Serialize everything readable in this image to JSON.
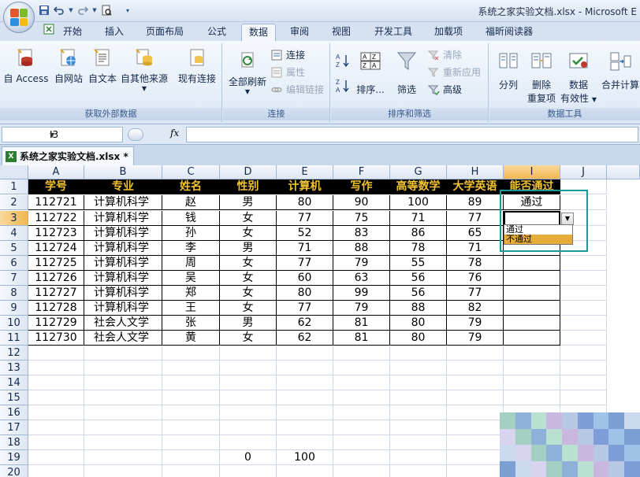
{
  "window": {
    "title": "系统之家实验文档.xlsx - Microsoft E"
  },
  "qat": {
    "icons": [
      "save-icon",
      "undo-icon",
      "redo-icon",
      "print-preview-icon",
      "customize-icon"
    ]
  },
  "tabs": [
    "开始",
    "插入",
    "页面布局",
    "公式",
    "数据",
    "审阅",
    "视图",
    "开发工具",
    "加载项",
    "福昕阅读器"
  ],
  "active_tab": "数据",
  "ribbon": {
    "groups": {
      "external": {
        "label": "获取外部数据",
        "buttons": [
          "自 Access",
          "自网站",
          "自文本",
          "自其他来源",
          "现有连接"
        ]
      },
      "connections": {
        "label": "连接",
        "refresh": "全部刷新",
        "items": [
          "连接",
          "属性",
          "编辑链接"
        ]
      },
      "sort_filter": {
        "label": "排序和筛选",
        "sort": "排序...",
        "filter": "筛选",
        "items": [
          "清除",
          "重新应用",
          "高级"
        ]
      },
      "data_tools": {
        "label": "数据工具",
        "split": "分列",
        "remove_dup_1": "删除",
        "remove_dup_2": "重复项",
        "validation_1": "数据",
        "validation_2": "有效性",
        "consolidate": "合并计算"
      }
    }
  },
  "formula_bar": {
    "namebox": "I3",
    "fx": "fx",
    "value": ""
  },
  "workbook_tab": {
    "name": "系统之家实验文档.xlsx *"
  },
  "columns": [
    "A",
    "B",
    "C",
    "D",
    "E",
    "F",
    "G",
    "H",
    "I",
    "J"
  ],
  "selected_column": "I",
  "selected_row": "3",
  "rows": [
    "1",
    "2",
    "3",
    "4",
    "5",
    "6",
    "7",
    "8",
    "9",
    "10",
    "11",
    "12",
    "13",
    "14",
    "15",
    "16",
    "17",
    "18",
    "19",
    "20"
  ],
  "table": {
    "headers": [
      "学号",
      "专业",
      "姓名",
      "性别",
      "计算机",
      "写作",
      "高等数学",
      "大学英语",
      "能否通过"
    ],
    "data": [
      [
        "112721",
        "计算机科学",
        "赵",
        "男",
        "80",
        "90",
        "100",
        "89",
        "通过"
      ],
      [
        "112722",
        "计算机科学",
        "钱",
        "女",
        "77",
        "75",
        "71",
        "77",
        ""
      ],
      [
        "112723",
        "计算机科学",
        "孙",
        "女",
        "52",
        "83",
        "86",
        "65",
        ""
      ],
      [
        "112724",
        "计算机科学",
        "李",
        "男",
        "71",
        "88",
        "78",
        "71",
        ""
      ],
      [
        "112725",
        "计算机科学",
        "周",
        "女",
        "77",
        "79",
        "55",
        "78",
        ""
      ],
      [
        "112726",
        "计算机科学",
        "吴",
        "女",
        "60",
        "63",
        "56",
        "76",
        ""
      ],
      [
        "112727",
        "计算机科学",
        "郑",
        "女",
        "80",
        "99",
        "56",
        "77",
        ""
      ],
      [
        "112728",
        "计算机科学",
        "王",
        "女",
        "77",
        "79",
        "88",
        "82",
        ""
      ],
      [
        "112729",
        "社会人文学",
        "张",
        "男",
        "62",
        "81",
        "80",
        "79",
        ""
      ],
      [
        "112730",
        "社会人文学",
        "黄",
        "女",
        "62",
        "81",
        "80",
        "79",
        ""
      ]
    ]
  },
  "row19": {
    "D": "0",
    "E": "100"
  },
  "dropdown": {
    "options": [
      "通过",
      "不通过"
    ],
    "highlighted": "不通过"
  }
}
